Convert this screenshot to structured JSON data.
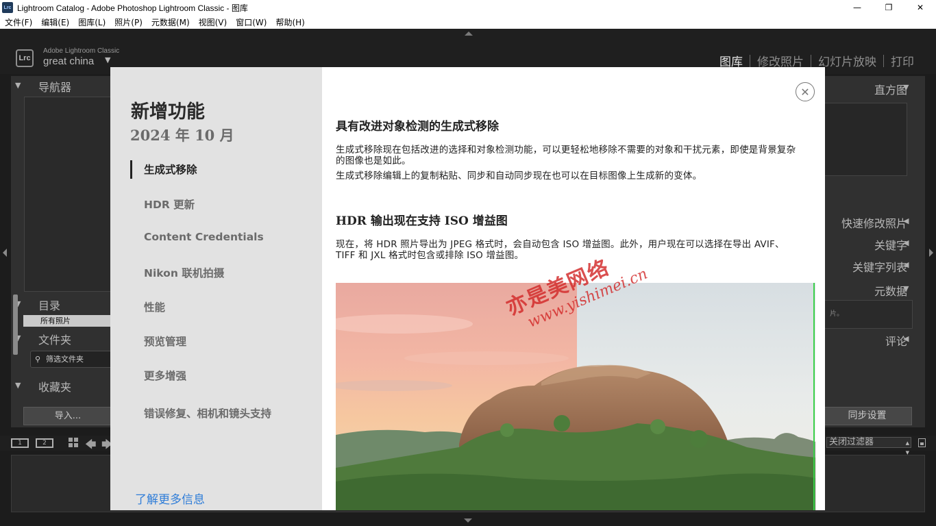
{
  "window": {
    "icon_text": "Lrc",
    "title": "Lightroom Catalog - Adobe Photoshop Lightroom Classic - 图库",
    "minimize": "—",
    "maximize": "❐",
    "close": "✕"
  },
  "menu": [
    "文件(F)",
    "编辑(E)",
    "图库(L)",
    "照片(P)",
    "元数据(M)",
    "视图(V)",
    "窗口(W)",
    "帮助(H)"
  ],
  "header": {
    "logo": "Lrc",
    "brand": "Adobe Lightroom Classic",
    "catalog_name": "great china",
    "catalog_caret": "▼",
    "modules": [
      "图库",
      "修改照片",
      "幻灯片放映",
      "打印"
    ]
  },
  "left_panel": {
    "navigator": "导航器",
    "catalog": "目录",
    "all_photos": "所有照片",
    "folders": "文件夹",
    "filter_folders": "筛选文件夹",
    "collections": "收藏夹",
    "import_button": "导入..."
  },
  "right_panel": {
    "histogram": "直方图",
    "quick_develop": "快速修改照片",
    "keywording": "关键字",
    "keyword_list": "关键字列表",
    "metadata": "元数据",
    "metadata_hint": "片。",
    "comments": "评论",
    "sync_button": "同步设置"
  },
  "filmstrip": {
    "screen1": "1",
    "screen2": "2",
    "filter_label": "关闭过滤器"
  },
  "dialog": {
    "title": "新增功能",
    "date": "2024 年 10 月",
    "nav": [
      "生成式移除",
      "HDR 更新",
      "Content Credentials",
      "Nikon 联机拍摄",
      "性能",
      "预览管理",
      "更多增强",
      "错误修复、相机和镜头支持"
    ],
    "learn_more": "了解更多信息",
    "section1_title": "具有改进对象检测的生成式移除",
    "section1_p1": "生成式移除现在包括改进的选择和对象检测功能，可以更轻松地移除不需要的对象和干扰元素，即使是背景复杂的图像也是如此。",
    "section1_p2": "生成式移除编辑上的复制粘贴、同步和自动同步现在也可以在目标图像上生成新的变体。",
    "section2_title": "HDR 输出现在支持 ISO 增益图",
    "section2_p1": "现在，将 HDR 照片导出为 JPEG 格式时，会自动包含 ISO 增益图。此外，用户现在可以选择在导出 AVIF、TIFF 和 JXL 格式时包含或排除 ISO 增益图。",
    "close_icon": "✕"
  },
  "watermark": {
    "line1": "亦是美网络",
    "line2": "www.yishimei.cn"
  }
}
